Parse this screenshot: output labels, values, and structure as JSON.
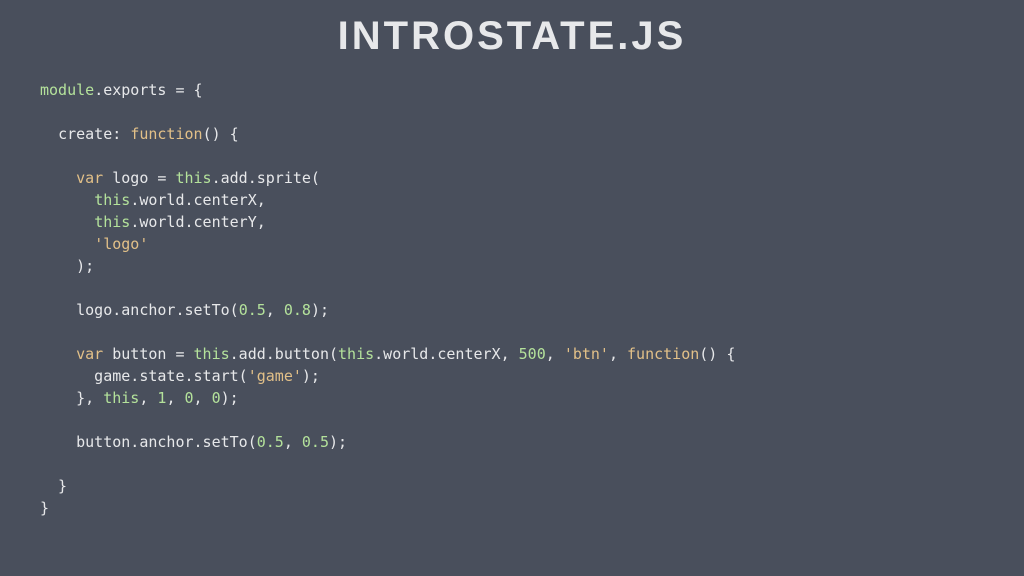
{
  "title": "INTROSTATE.JS",
  "code": {
    "tokens": [
      [
        {
          "c": "t-key",
          "t": "module"
        },
        {
          "c": "t-punc",
          "t": "."
        },
        {
          "c": "t-prop",
          "t": "exports"
        },
        {
          "c": "t-punc",
          "t": " = {"
        }
      ],
      [],
      [
        {
          "c": "t-punc",
          "t": "  "
        },
        {
          "c": "t-prop",
          "t": "create"
        },
        {
          "c": "t-punc",
          "t": ": "
        },
        {
          "c": "t-fnkey",
          "t": "function"
        },
        {
          "c": "t-punc",
          "t": "() {"
        }
      ],
      [],
      [
        {
          "c": "t-punc",
          "t": "    "
        },
        {
          "c": "t-fnkey",
          "t": "var"
        },
        {
          "c": "t-punc",
          "t": " "
        },
        {
          "c": "t-prop",
          "t": "logo"
        },
        {
          "c": "t-punc",
          "t": " = "
        },
        {
          "c": "t-key",
          "t": "this"
        },
        {
          "c": "t-punc",
          "t": ".add.sprite("
        }
      ],
      [
        {
          "c": "t-punc",
          "t": "      "
        },
        {
          "c": "t-key",
          "t": "this"
        },
        {
          "c": "t-punc",
          "t": ".world.centerX,"
        }
      ],
      [
        {
          "c": "t-punc",
          "t": "      "
        },
        {
          "c": "t-key",
          "t": "this"
        },
        {
          "c": "t-punc",
          "t": ".world.centerY,"
        }
      ],
      [
        {
          "c": "t-punc",
          "t": "      "
        },
        {
          "c": "t-str",
          "t": "'logo'"
        }
      ],
      [
        {
          "c": "t-punc",
          "t": "    );"
        }
      ],
      [],
      [
        {
          "c": "t-punc",
          "t": "    logo.anchor.setTo("
        },
        {
          "c": "t-num",
          "t": "0.5"
        },
        {
          "c": "t-punc",
          "t": ", "
        },
        {
          "c": "t-num",
          "t": "0.8"
        },
        {
          "c": "t-punc",
          "t": ");"
        }
      ],
      [],
      [
        {
          "c": "t-punc",
          "t": "    "
        },
        {
          "c": "t-fnkey",
          "t": "var"
        },
        {
          "c": "t-punc",
          "t": " "
        },
        {
          "c": "t-prop",
          "t": "button"
        },
        {
          "c": "t-punc",
          "t": " = "
        },
        {
          "c": "t-key",
          "t": "this"
        },
        {
          "c": "t-punc",
          "t": ".add.button("
        },
        {
          "c": "t-key",
          "t": "this"
        },
        {
          "c": "t-punc",
          "t": ".world.centerX, "
        },
        {
          "c": "t-num",
          "t": "500"
        },
        {
          "c": "t-punc",
          "t": ", "
        },
        {
          "c": "t-str",
          "t": "'btn'"
        },
        {
          "c": "t-punc",
          "t": ", "
        },
        {
          "c": "t-fnkey",
          "t": "function"
        },
        {
          "c": "t-punc",
          "t": "() {"
        }
      ],
      [
        {
          "c": "t-punc",
          "t": "      game.state.start("
        },
        {
          "c": "t-str",
          "t": "'game'"
        },
        {
          "c": "t-punc",
          "t": ");"
        }
      ],
      [
        {
          "c": "t-punc",
          "t": "    }, "
        },
        {
          "c": "t-key",
          "t": "this"
        },
        {
          "c": "t-punc",
          "t": ", "
        },
        {
          "c": "t-num",
          "t": "1"
        },
        {
          "c": "t-punc",
          "t": ", "
        },
        {
          "c": "t-num",
          "t": "0"
        },
        {
          "c": "t-punc",
          "t": ", "
        },
        {
          "c": "t-num",
          "t": "0"
        },
        {
          "c": "t-punc",
          "t": ");"
        }
      ],
      [],
      [
        {
          "c": "t-punc",
          "t": "    button.anchor.setTo("
        },
        {
          "c": "t-num",
          "t": "0.5"
        },
        {
          "c": "t-punc",
          "t": ", "
        },
        {
          "c": "t-num",
          "t": "0.5"
        },
        {
          "c": "t-punc",
          "t": ");"
        }
      ],
      [],
      [
        {
          "c": "t-punc",
          "t": "  }"
        }
      ],
      [
        {
          "c": "t-punc",
          "t": "}"
        }
      ]
    ]
  }
}
